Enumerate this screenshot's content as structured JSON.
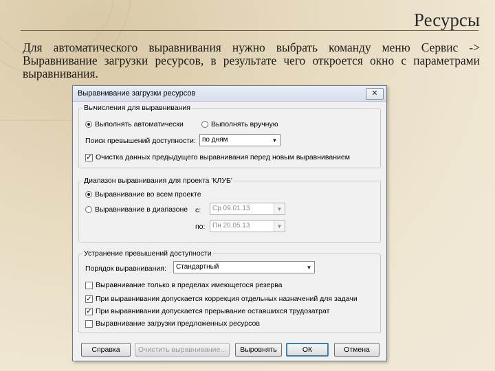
{
  "slide": {
    "title": "Ресурсы",
    "body": "Для автоматического выравнивания нужно выбрать команду меню Сервис -> Выравнивание загрузки ресурсов, в результате чего откроется окно с параметрами выравнивания."
  },
  "dialog": {
    "title": "Выравнивание загрузки ресурсов",
    "close_label": "✕",
    "calc": {
      "legend": "Вычисления для выравнивания",
      "auto_label": "Выполнять автоматически",
      "manual_label": "Выполнять вручную",
      "mode_selected": "auto",
      "search_label": "Поиск превышений доступности:",
      "search_value": "по дням",
      "clear_label": "Очистка данных предыдущего выравнивания перед новым выравниванием",
      "clear_checked": true
    },
    "range": {
      "legend": "Диапазон выравнивания для проекта 'КЛУБ'",
      "all_label": "Выравнивание во всем проекте",
      "range_label": "Выравнивание в диапазоне",
      "selected": "all",
      "from_label": "с:",
      "from_value": "Ср 09.01.13",
      "to_label": "по:",
      "to_value": "Пн 20.05.13"
    },
    "resolve": {
      "legend": "Устранение превышений доступности",
      "order_label": "Порядок выравнивания:",
      "order_value": "Стандартный",
      "options": [
        {
          "label": "Выравнивание только в пределах имеющегося резерва",
          "checked": false
        },
        {
          "label": "При выравнивании допускается коррекция отдельных назначений для задачи",
          "checked": true
        },
        {
          "label": "При выравнивании допускается прерывание оставшихся трудозатрат",
          "checked": true
        },
        {
          "label": "Выравнивание загрузки предложенных ресурсов",
          "checked": false
        }
      ]
    },
    "buttons": {
      "help": "Справка",
      "clear": "Очистить выравнивание...",
      "level": "Выровнять",
      "ok": "ОК",
      "cancel": "Отмена"
    }
  }
}
